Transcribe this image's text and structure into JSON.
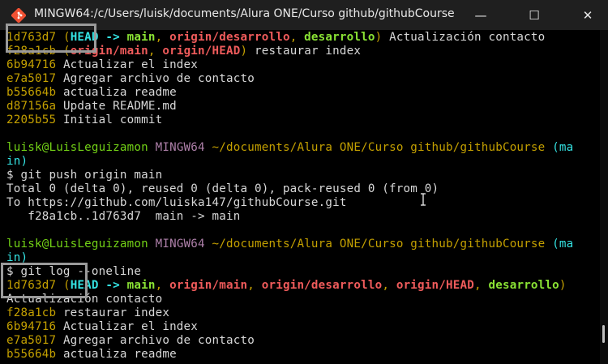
{
  "window": {
    "title": "MINGW64:/c/Users/luisk/documents/Alura ONE/Curso github/githubCourse",
    "minimize_glyph": "—",
    "maximize_glyph": "☐",
    "close_glyph": "✕"
  },
  "terminal": {
    "log1": [
      {
        "hash": "1d763d7",
        "refs_open": " (",
        "head": "HEAD -> ",
        "r1": "main",
        "s1": ", ",
        "r2": "origin/desarrollo",
        "s2": ", ",
        "r3": "desarrollo",
        "refs_close": ")",
        "msg": " Actualización contacto"
      },
      {
        "hash": "f28a1cb",
        "refs_open": " (",
        "r1": "origin/main",
        "s1": ", ",
        "r2": "origin/HEAD",
        "refs_close": ")",
        "msg": " restaurar index"
      },
      {
        "hash": "6b94716",
        "msg": " Actualizar el index"
      },
      {
        "hash": "e7a5017",
        "msg": " Agregar archivo de contacto"
      },
      {
        "hash": "b55664b",
        "msg": " actualiza readme"
      },
      {
        "hash": "d87156a",
        "msg": " Update README.md"
      },
      {
        "hash": "2205b55",
        "msg": " Initial commit"
      }
    ],
    "prompt": {
      "user": "luisk@LuisLeguizamon",
      "env": "MINGW64",
      "path": "~/documents/Alura ONE/Curso github/githubCourse",
      "branch_wrap_1": " (ma",
      "branch_wrap_2": "in)"
    },
    "push_cmd": "$ git push origin main",
    "push_out": [
      "Total 0 (delta 0), reused 0 (delta 0), pack-reused 0 (from 0)",
      "To https://github.com/luiska147/githubCourse.git",
      "   f28a1cb..1d763d7  main -> main"
    ],
    "log_cmd": "$ git log --oneline",
    "log2_first": {
      "hash": "1d763d7",
      "refs_open": " (",
      "head": "HEAD -> ",
      "r1": "main",
      "s1": ", ",
      "r2": "origin/main",
      "s2": ", ",
      "r3": "origin/desarrollo",
      "s3": ", ",
      "r4": "origin/HEAD",
      "s4": ", ",
      "r5": "desarrollo",
      "refs_close": ")"
    },
    "log2_wrap": "Actualización contacto",
    "log2": [
      {
        "hash": "f28a1cb",
        "msg": " restaurar index"
      },
      {
        "hash": "6b94716",
        "msg": " Actualizar el index"
      },
      {
        "hash": "e7a5017",
        "msg": " Agregar archivo de contacto"
      },
      {
        "hash": "b55664b",
        "msg": " actualiza readme"
      }
    ]
  }
}
